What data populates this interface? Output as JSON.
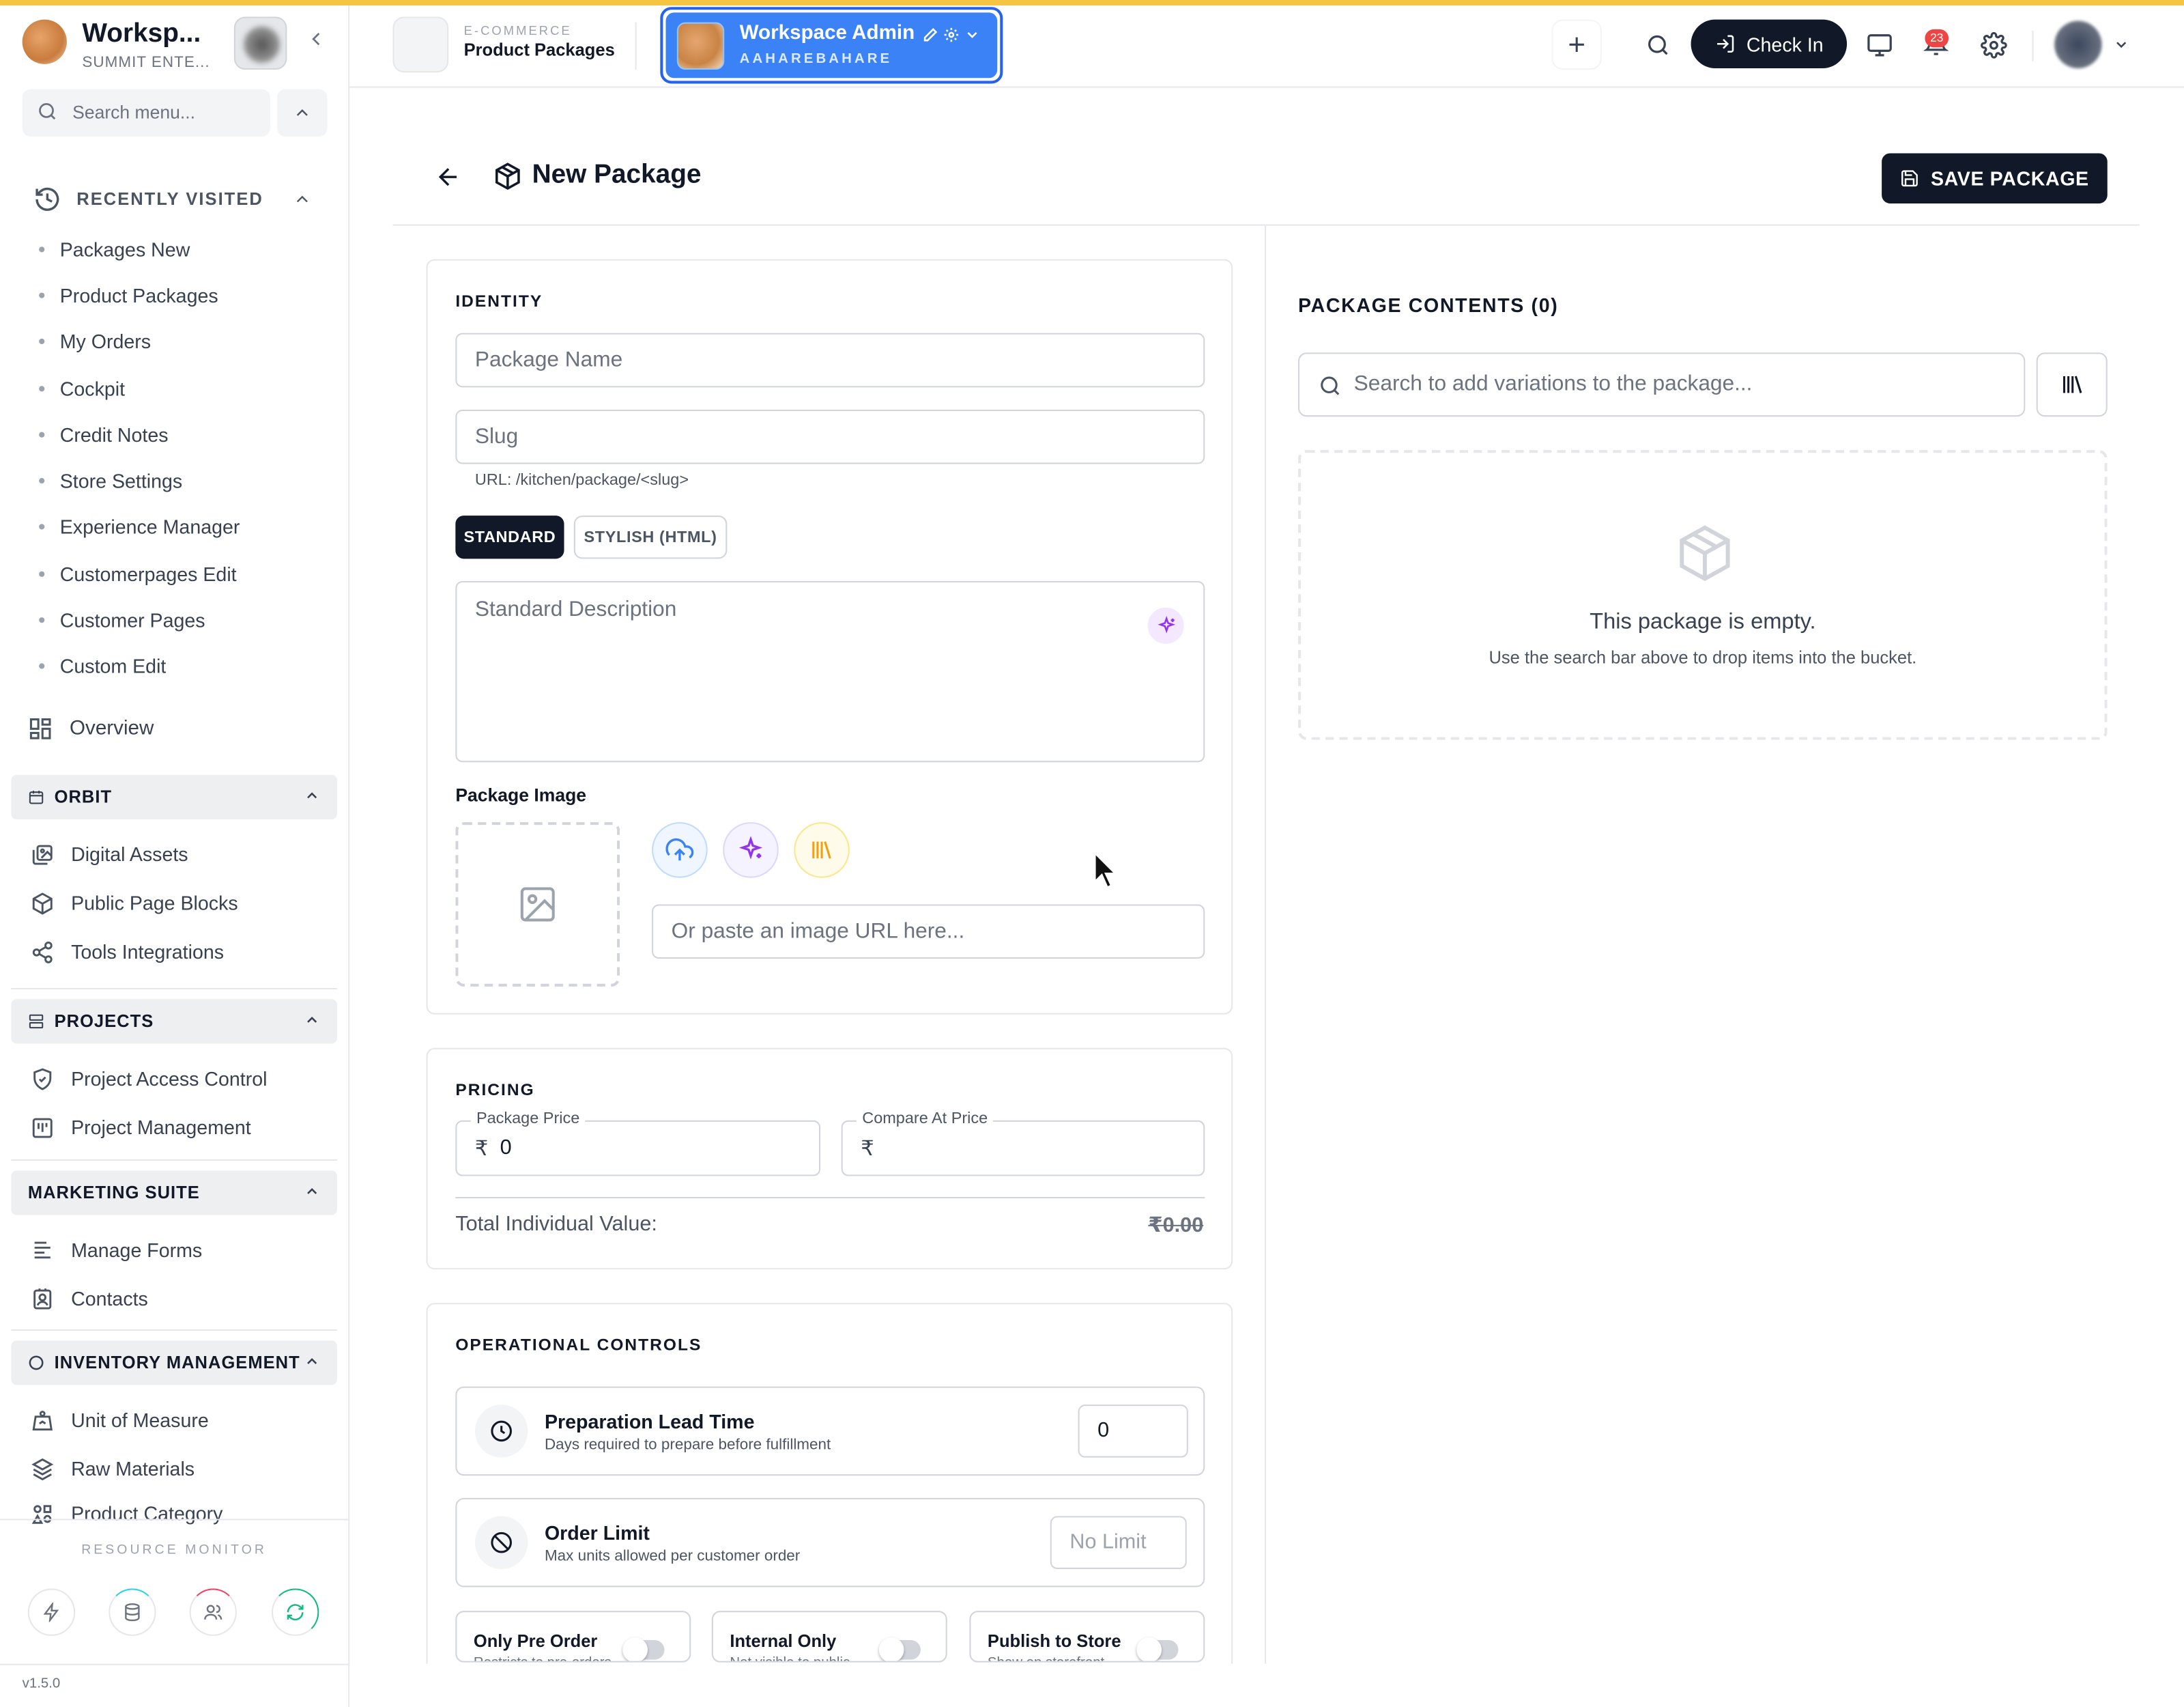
{
  "sidebar": {
    "workspace_name": "Worksp...",
    "workspace_sub": "SUMMIT ENTE...",
    "search_placeholder": "Search menu...",
    "recently_visited_label": "RECENTLY VISITED",
    "recent_items": [
      "Packages New",
      "Product Packages",
      "My Orders",
      "Cockpit",
      "Credit Notes",
      "Store Settings",
      "Experience Manager",
      "Customerpages Edit",
      "Customer Pages",
      "Custom Edit"
    ],
    "overview": "Overview",
    "sections": {
      "orbit": {
        "label": "ORBIT",
        "items": [
          "Digital Assets",
          "Public Page Blocks",
          "Tools Integrations"
        ]
      },
      "projects": {
        "label": "PROJECTS",
        "items": [
          "Project Access Control",
          "Project Management"
        ]
      },
      "marketing": {
        "label": "MARKETING SUITE",
        "items": [
          "Manage Forms",
          "Contacts"
        ]
      },
      "inventory": {
        "label": "INVENTORY MANAGEMENT",
        "items": [
          "Unit of Measure",
          "Raw Materials",
          "Product Category"
        ]
      }
    },
    "resource_monitor": "RESOURCE MONITOR",
    "version": "v1.5.0"
  },
  "topbar": {
    "module_sup": "E-COMMERCE",
    "module_name": "Product Packages",
    "workspace_title": "Workspace Admin",
    "workspace_subtitle": "AAHAREBAHARE",
    "check_in": "Check In",
    "notifications_count": "23"
  },
  "page": {
    "title": "New Package",
    "save_label": "SAVE PACKAGE"
  },
  "identity": {
    "title": "IDENTITY",
    "name_placeholder": "Package Name",
    "slug_placeholder": "Slug",
    "url_hint": "URL: /kitchen/package/<slug>",
    "tab_standard": "STANDARD",
    "tab_stylish": "STYLISH (HTML)",
    "description_placeholder": "Standard Description",
    "image_label": "Package Image",
    "image_url_placeholder": "Or paste an image URL here..."
  },
  "pricing": {
    "title": "PRICING",
    "package_price_label": "Package Price",
    "package_price_value": "0",
    "compare_price_label": "Compare At Price",
    "currency": "₹",
    "total_label": "Total Individual Value:",
    "total_value": "₹0.00"
  },
  "operational": {
    "title": "OPERATIONAL CONTROLS",
    "lead_time_title": "Preparation Lead Time",
    "lead_time_sub": "Days required to prepare before fulfillment",
    "lead_time_value": "0",
    "order_limit_title": "Order Limit",
    "order_limit_sub": "Max units allowed per customer order",
    "order_limit_placeholder": "No Limit",
    "toggles": [
      {
        "title": "Only Pre Order",
        "sub": "Restricts to pre-orders",
        "on": false
      },
      {
        "title": "Internal Only",
        "sub": "Not visible to public",
        "on": false
      },
      {
        "title": "Publish to Store",
        "sub": "Show on storefront",
        "on": false
      }
    ]
  },
  "contents": {
    "title": "PACKAGE CONTENTS (0)",
    "search_placeholder": "Search to add variations to the package...",
    "empty_title": "This package is empty.",
    "empty_sub": "Use the search bar above to drop items into the bucket."
  },
  "colors": {
    "accent": "#3b82f6",
    "dark": "#111827",
    "top_strip": "#f5c542",
    "badge": "#ef4444"
  }
}
